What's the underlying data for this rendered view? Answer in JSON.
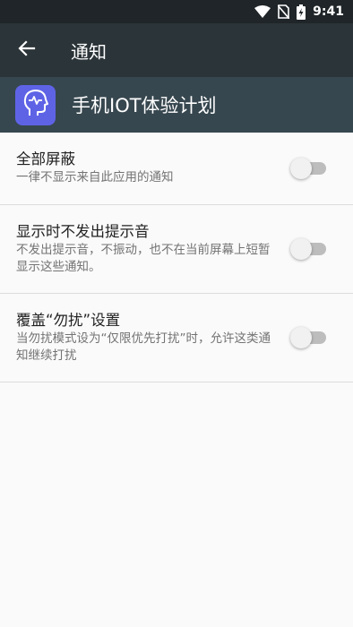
{
  "status_bar": {
    "time": "9:41",
    "icons": [
      "wifi-icon",
      "no-sim-icon",
      "battery-charging-icon"
    ]
  },
  "app_bar": {
    "title": "通知",
    "back_icon": "arrow-back-icon"
  },
  "app_header": {
    "icon": "head-pulse-icon",
    "name": "手机IOT体验计划"
  },
  "settings": [
    {
      "title": "全部屏蔽",
      "subtitle": "一律不显示来自此应用的通知",
      "enabled": false
    },
    {
      "title": "显示时不发出提示音",
      "subtitle": "不发出提示音，不振动，也不在当前屏幕上短暂显示这些通知。",
      "enabled": false
    },
    {
      "title": "覆盖“勿扰”设置",
      "subtitle": "当勿扰模式设为“仅限优先打扰”时，允许这类通知继续打扰",
      "enabled": false
    }
  ],
  "colors": {
    "status_bar": "#1f2528",
    "app_bar": "#2b3438",
    "app_header": "#37474f",
    "app_icon": "#5e63e6",
    "background": "#fafafa"
  }
}
